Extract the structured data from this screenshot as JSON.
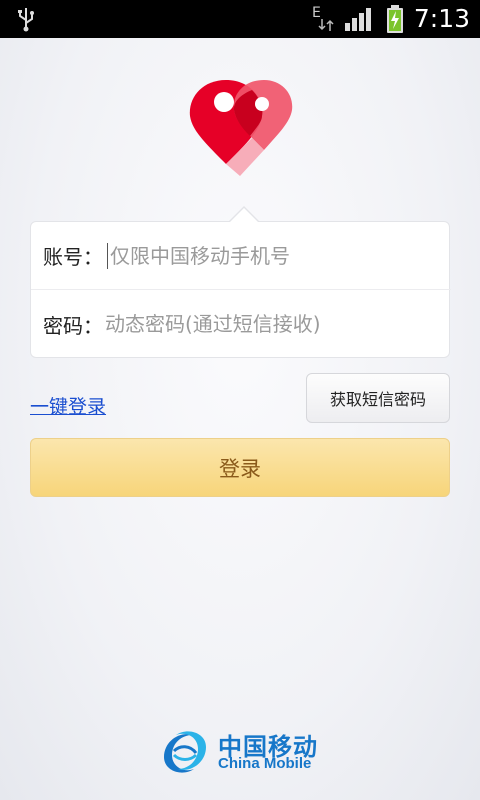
{
  "status_bar": {
    "time": "7:13",
    "network_type": "E"
  },
  "form": {
    "account_label": "账号：",
    "account_placeholder": "仅限中国移动手机号",
    "password_label": "密码：",
    "password_placeholder": "动态密码(通过短信接收)"
  },
  "actions": {
    "onekey_login_label": "一键登录",
    "get_sms_code_label": "获取短信密码",
    "login_label": "登录"
  },
  "brand": {
    "name_cn": "中国移动",
    "name_en": "China Mobile"
  },
  "colors": {
    "logo_red": "#e60027",
    "logo_pink": "#f0556a",
    "link_blue": "#1a4ed0",
    "brand_blue": "#1777c9",
    "login_yellow": "#f7d57a"
  }
}
